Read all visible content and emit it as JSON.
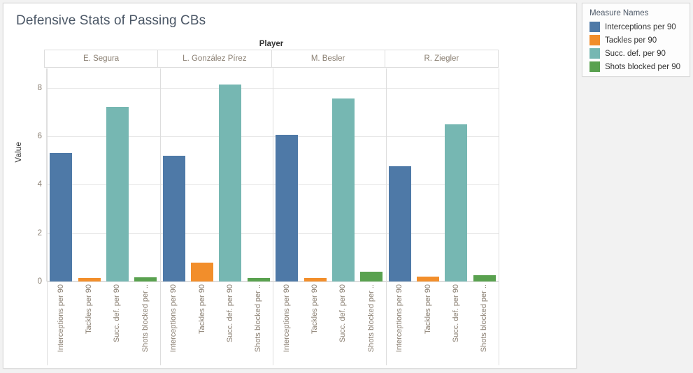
{
  "viz": {
    "title": "Defensive Stats of Passing CBs",
    "column_field_label": "Player",
    "yaxis_title": "Value"
  },
  "legend": {
    "title": "Measure Names",
    "items": [
      {
        "label": "Interceptions per 90",
        "color": "#4e79a7"
      },
      {
        "label": "Tackles per 90",
        "color": "#f28e2b"
      },
      {
        "label": "Succ. def. per 90",
        "color": "#76b7b2"
      },
      {
        "label": "Shots blocked per 90",
        "color": "#59a14f"
      }
    ]
  },
  "chart_data": {
    "type": "bar",
    "title": "Defensive Stats of Passing CBs",
    "xlabel": "Player",
    "ylabel": "Value",
    "ylim": [
      0,
      8.8
    ],
    "yticks": [
      0,
      2,
      4,
      6,
      8
    ],
    "grid": true,
    "legend_position": "right",
    "legend_title": "Measure Names",
    "panel_field": "Player",
    "panels": [
      "E. Segura",
      "L. González Pírez",
      "M. Besler",
      "R. Ziegler"
    ],
    "categories": [
      "Interceptions per 90",
      "Tackles per 90",
      "Succ. def. per 90",
      "Shots blocked per .."
    ],
    "category_full_names": [
      "Interceptions per 90",
      "Tackles per 90",
      "Succ. def. per 90",
      "Shots blocked per 90"
    ],
    "colors": [
      "#4e79a7",
      "#f28e2b",
      "#76b7b2",
      "#59a14f"
    ],
    "series": [
      {
        "name": "Interceptions per 90",
        "values": [
          5.3,
          5.2,
          6.07,
          4.77
        ]
      },
      {
        "name": "Tackles per 90",
        "values": [
          0.14,
          0.78,
          0.15,
          0.2
        ]
      },
      {
        "name": "Succ. def. per 90",
        "values": [
          7.2,
          8.15,
          7.55,
          6.5
        ]
      },
      {
        "name": "Shots blocked per 90",
        "values": [
          0.18,
          0.14,
          0.4,
          0.27
        ]
      }
    ],
    "panel_values": [
      {
        "panel": "E. Segura",
        "values": [
          5.3,
          0.14,
          7.2,
          0.18
        ]
      },
      {
        "panel": "L. González Pírez",
        "values": [
          5.2,
          0.78,
          8.15,
          0.14
        ]
      },
      {
        "panel": "M. Besler",
        "values": [
          6.07,
          0.15,
          7.55,
          0.4
        ]
      },
      {
        "panel": "R. Ziegler",
        "values": [
          4.77,
          0.2,
          6.5,
          0.27
        ]
      }
    ]
  }
}
